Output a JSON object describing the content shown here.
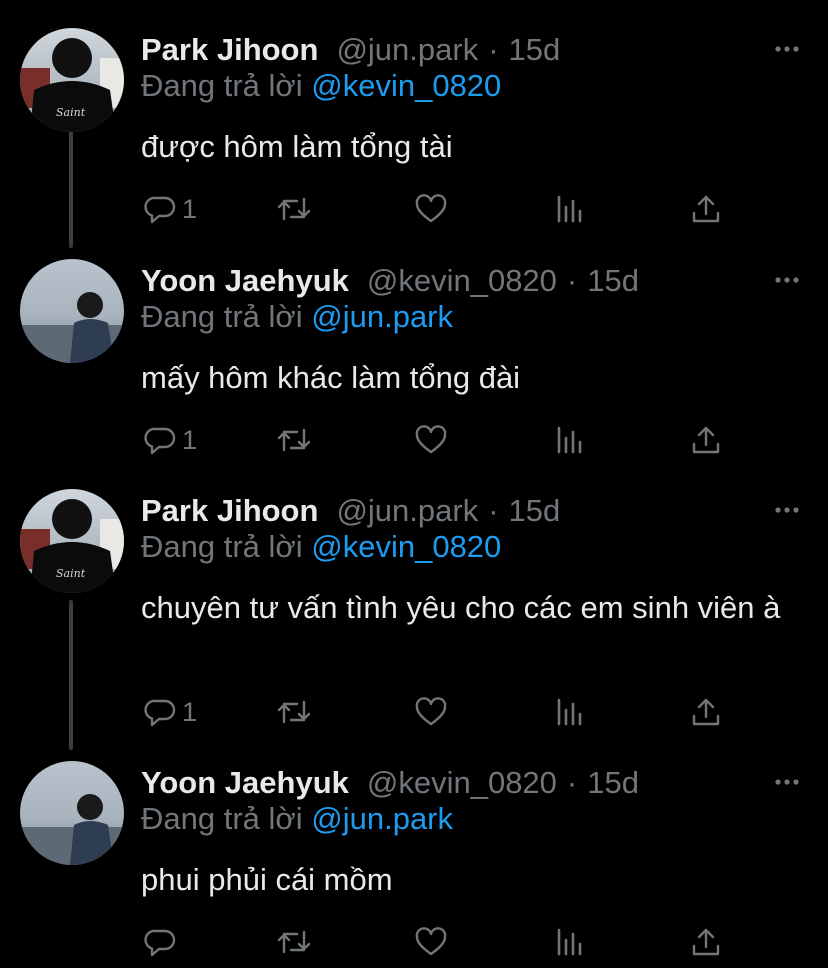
{
  "colors": {
    "background": "#000000",
    "text_primary": "#e7e9ea",
    "text_secondary": "#71767b",
    "mention": "#1d9bf0",
    "thread_line": "#3a3d41"
  },
  "icons": {
    "more": "more-horizontal-icon",
    "reply": "reply-bubble-icon",
    "retweet": "retweet-icon",
    "like": "heart-icon",
    "views": "bar-chart-icon",
    "share": "share-upload-icon"
  },
  "tweets": [
    {
      "name": "Park Jihoon",
      "handle": "@jun.park",
      "separator": "·",
      "time": "15d",
      "reply_prefix": "Đang trả lời",
      "reply_to": "@kevin_0820",
      "text": "được hôm làm tổng tài",
      "reply_count": "1"
    },
    {
      "name": "Yoon Jaehyuk",
      "handle": "@kevin_0820",
      "separator": "·",
      "time": "15d",
      "reply_prefix": "Đang trả lời",
      "reply_to": "@jun.park",
      "text": "mấy hôm khác làm tổng đài",
      "reply_count": "1"
    },
    {
      "name": "Park Jihoon",
      "handle": "@jun.park",
      "separator": "·",
      "time": "15d",
      "reply_prefix": "Đang trả lời",
      "reply_to": "@kevin_0820",
      "text": "chuyên tư vấn tình yêu cho các em sinh viên à",
      "reply_count": "1"
    },
    {
      "name": "Yoon Jaehyuk",
      "handle": "@kevin_0820",
      "separator": "·",
      "time": "15d",
      "reply_prefix": "Đang trả lời",
      "reply_to": "@jun.park",
      "text": "phui phủi cái mồm",
      "reply_count": ""
    }
  ]
}
